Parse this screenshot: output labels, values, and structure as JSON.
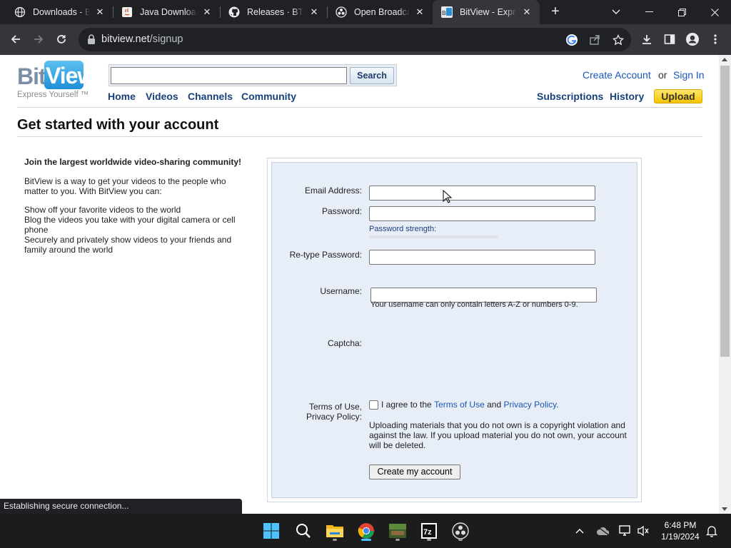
{
  "browser": {
    "tabs": [
      {
        "title": "Downloads - Bet",
        "icon": "globe-icon"
      },
      {
        "title": "Java Downloads",
        "icon": "java-icon"
      },
      {
        "title": "Releases · BTW-",
        "icon": "github-icon"
      },
      {
        "title": "Open Broadcast",
        "icon": "obs-icon"
      },
      {
        "title": "BitView - Expres",
        "icon": "bitview-icon",
        "active": true
      }
    ],
    "url_host": "bitview.net",
    "url_path": "/signup",
    "status_text": "Establishing secure connection..."
  },
  "site": {
    "logo": {
      "bit": "Bit",
      "view": "View",
      "tagline": "Express Yourself ™"
    },
    "search": {
      "button_label": "Search",
      "placeholder": ""
    },
    "nav": {
      "home": "Home",
      "videos": "Videos",
      "channels": "Channels",
      "community": "Community"
    },
    "account": {
      "create": "Create Account",
      "or": "or",
      "signin": "Sign In"
    },
    "usernav": {
      "subscriptions": "Subscriptions",
      "history": "History",
      "upload": "Upload"
    }
  },
  "page": {
    "title": "Get started with your account",
    "intro": {
      "heading": "Join the largest worldwide video-sharing community!",
      "paragraph": "BitView is a way to get your videos to the people who matter to you. With BitView you can:",
      "bullets": [
        "Show off your favorite videos to the world",
        "Blog the videos you take with your digital camera or cell phone",
        "Securely and privately show videos to your friends and family around the world"
      ]
    },
    "form": {
      "email_label": "Email Address:",
      "password_label": "Password:",
      "password_strength": "Password strength:",
      "retype_label": "Re-type Password:",
      "username_label": "Username:",
      "username_note": "Your username can only contain letters A-Z or numbers 0-9.",
      "captcha_label": "Captcha:",
      "terms_label_1": "Terms of Use,",
      "terms_label_2": "Privacy Policy:",
      "agree_prefix": "I agree to the",
      "terms_link": "Terms of Use",
      "agree_and": "and",
      "privacy_link": "Privacy Policy.",
      "warning": "Uploading materials that you do not own is a copyright violation and against the law. If you upload material you do not own, your account will be deleted.",
      "submit": "Create my account",
      "email_value": "",
      "password_value": "",
      "retype_value": "",
      "username_value": "",
      "agree_checked": false
    }
  },
  "taskbar": {
    "apps": [
      "windows-start-icon",
      "search-icon",
      "file-explorer-icon",
      "chrome-icon",
      "minecraft-icon",
      "7zip-icon",
      "obs-icon"
    ],
    "time": "6:48 PM",
    "date": "1/19/2024"
  },
  "colors": {
    "link": "#1a56b8",
    "nav": "#17417a",
    "upload_bg": "#f5c400",
    "form_bg": "#e8eef7",
    "chrome_dark": "#202124",
    "chrome_toolbar": "#35363a"
  }
}
